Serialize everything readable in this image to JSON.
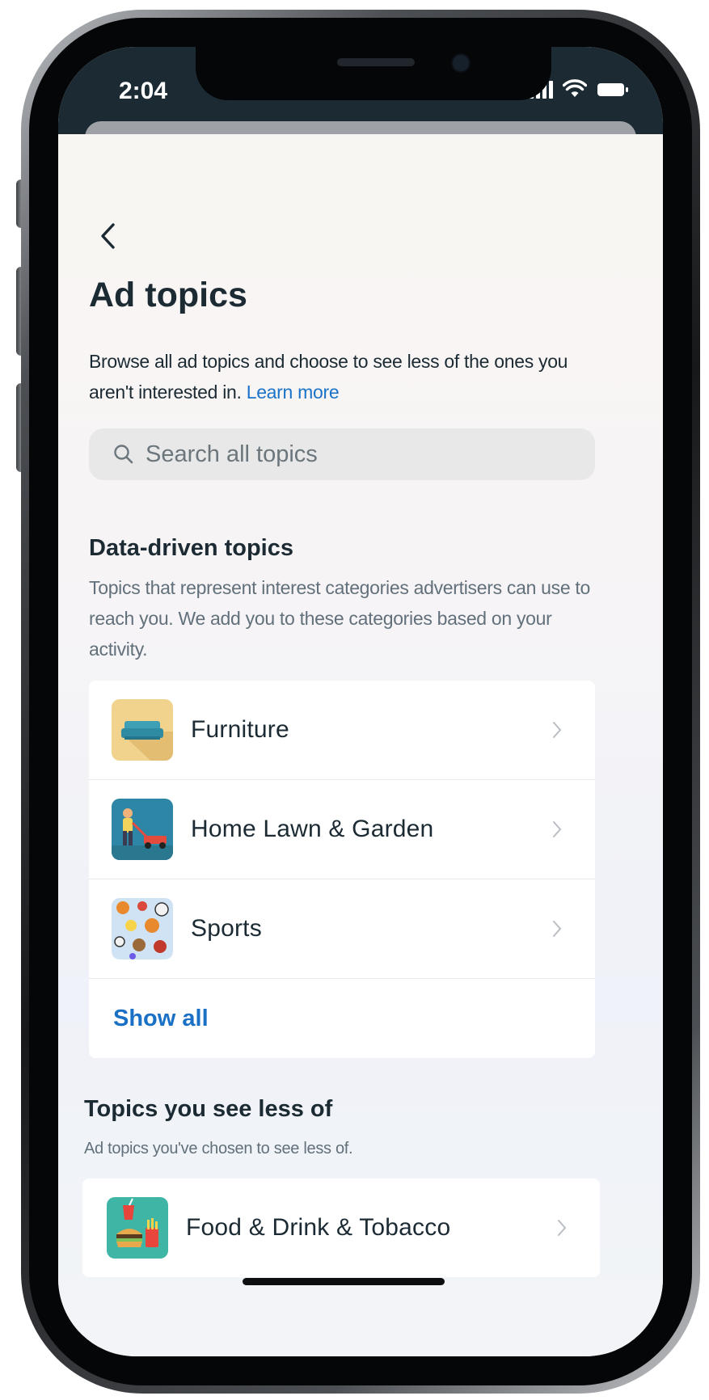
{
  "status_bar": {
    "time": "2:04",
    "icons": [
      "signal-icon",
      "wifi-icon",
      "battery-icon"
    ]
  },
  "header": {
    "back_icon": "chevron-left-icon",
    "title": "Ad topics",
    "description": "Browse all ad topics and choose to see less of the ones you aren't interested in.",
    "learn_more": "Learn more"
  },
  "search": {
    "placeholder": "Search all topics",
    "icon": "search-icon"
  },
  "data_driven": {
    "title": "Data-driven topics",
    "description": "Topics that represent interest categories advertisers can use to reach you. We add you to these categories based on your activity.",
    "items": [
      {
        "label": "Furniture",
        "icon": "sofa-icon"
      },
      {
        "label": "Home Lawn & Garden",
        "icon": "lawn-mower-icon"
      },
      {
        "label": "Sports",
        "icon": "sports-balls-icon"
      }
    ],
    "show_all": "Show all"
  },
  "see_less": {
    "title": "Topics you see less of",
    "description": "Ad topics you've chosen to see less of.",
    "items": [
      {
        "label": "Food & Drink & Tobacco",
        "icon": "fast-food-icon"
      }
    ]
  },
  "colors": {
    "accent": "#1a73c8",
    "text_primary": "#1c2b33",
    "text_secondary": "#61707a",
    "status_bar_bg": "#1b2a33"
  }
}
